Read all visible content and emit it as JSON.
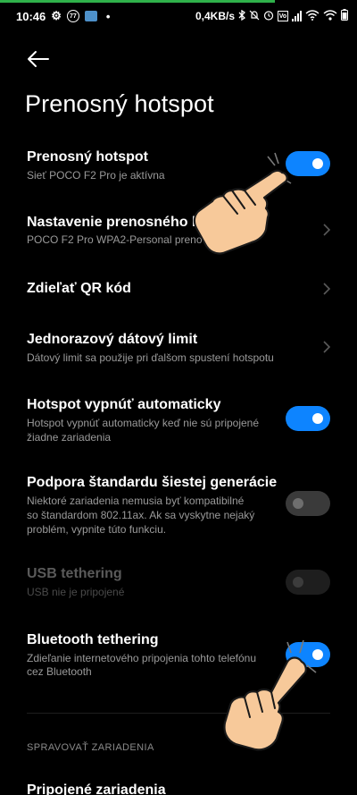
{
  "status_bar": {
    "time": "10:46",
    "badge": "77",
    "dot": "•",
    "speed": "0,4KB/s",
    "sim_box": "Vo"
  },
  "header": {
    "back_icon": "arrow-left-icon",
    "title": "Prenosný hotspot"
  },
  "rows": [
    {
      "title": "Prenosný hotspot",
      "subtitle": "Sieť POCO F2 Pro je aktívna",
      "toggle_on": true
    },
    {
      "title": "Nastavenie prenosného ho",
      "subtitle": "POCO F2 Pro WPA2-Personal preno"
    },
    {
      "title": "Zdieľať QR kód"
    },
    {
      "title": "Jednorazový dátový limit",
      "subtitle": "Dátový limit sa použije pri ďalšom spustení hotspotu"
    },
    {
      "title": "Hotspot vypnúť automaticky",
      "subtitle_lines": [
        "Hotspot vypnúť automaticky keď nie sú pripojené",
        "žiadne zariadenia"
      ],
      "toggle_on": true
    },
    {
      "title": "Podpora štandardu šiestej generácie",
      "subtitle_lines": [
        "Niektoré zariadenia nemusia byť kompatibilné",
        "so štandardom 802.11ax. Ak sa vyskytne nejaký",
        "problém, vypnite túto funkciu."
      ],
      "toggle_on": false
    },
    {
      "title": "USB tethering",
      "subtitle": "USB nie je pripojené",
      "toggle_on": false,
      "disabled": true
    },
    {
      "title": "Bluetooth tethering",
      "subtitle_lines": [
        "Zdieľanie internetového pripojenia tohto telefónu",
        "cez Bluetooth"
      ],
      "toggle_on": true
    }
  ],
  "section": {
    "header": "SPRAVOVAŤ ZARIADENIA",
    "next_row_title": "Pripojené zariadenia"
  },
  "colors": {
    "accent": "#0d84ff",
    "background": "#000000",
    "subtitle": "#9a9a9a",
    "progress": "#2fb14a"
  }
}
